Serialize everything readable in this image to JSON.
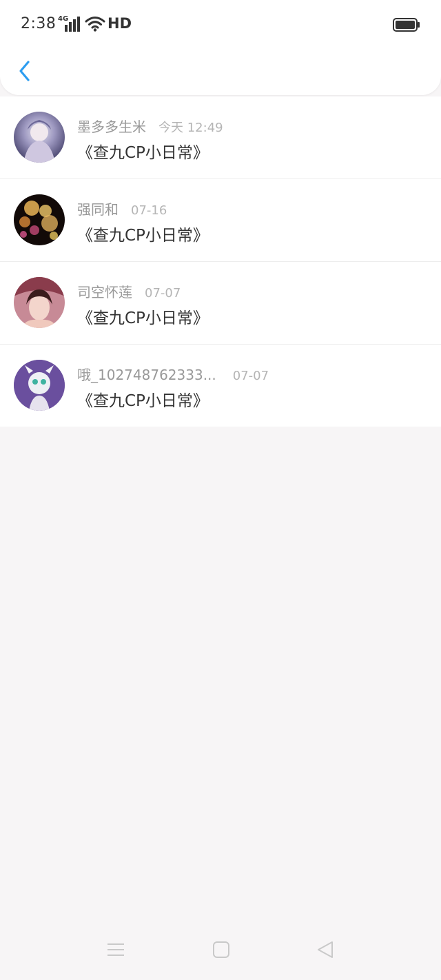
{
  "status_bar": {
    "time": "2:38",
    "network": "4G",
    "hd": "HD"
  },
  "header": {
    "back_icon": "chevron-left-icon"
  },
  "colors": {
    "accent": "#2d9df0",
    "text_primary": "#333333",
    "text_secondary": "#999999"
  },
  "items": [
    {
      "name": "墨多多生米",
      "date": "今天 12:49",
      "title": "《查九CP小日常》"
    },
    {
      "name": "强同和",
      "date": "07-16",
      "title": "《查九CP小日常》"
    },
    {
      "name": "司空怀莲",
      "date": "07-07",
      "title": "《查九CP小日常》"
    },
    {
      "name": "哦_102748762333...",
      "date": "07-07",
      "title": "《查九CP小日常》"
    }
  ],
  "nav_bar": {
    "icons": [
      "menu-icon",
      "home-icon",
      "back-triangle-icon"
    ]
  }
}
